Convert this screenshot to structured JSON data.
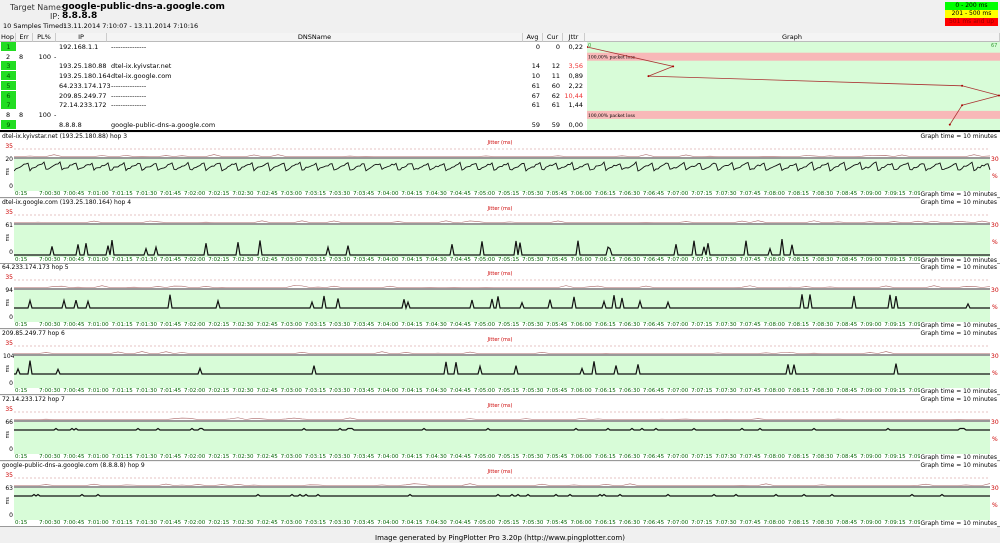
{
  "header": {
    "target_label": "Target Name:",
    "target_value": "google-public-dns-a.google.com",
    "ip_label": "IP:",
    "ip_value": "8.8.8.8",
    "samples_label": "10 Samples Timed:",
    "samples_value": "13.11.2014 7:10:07 - 13.11.2014 7:10:16"
  },
  "legend": [
    {
      "label": "0 - 200 ms",
      "color": "#00ff00"
    },
    {
      "label": "201 - 500 ms",
      "color": "#ffff00"
    },
    {
      "label": "501 ms and up",
      "color": "#ff0000"
    }
  ],
  "table": {
    "columns": [
      "Hop",
      "Err",
      "PL%",
      "IP",
      "DNSName",
      "Avg",
      "Cur",
      "Jttr",
      "Graph"
    ],
    "rows": [
      {
        "hop": "1",
        "err": "",
        "pl": "",
        "ip": "192.168.1.1",
        "dns": "---------------",
        "avg": "0",
        "cur": "0",
        "jttr": "0,22",
        "ok": true,
        "jttr_red": false
      },
      {
        "hop": "2",
        "err": "8",
        "pl": "100",
        "ip": "-",
        "dns": "",
        "avg": "",
        "cur": "",
        "jttr": "",
        "ok": false,
        "jttr_red": false
      },
      {
        "hop": "3",
        "err": "",
        "pl": "",
        "ip": "193.25.180.88",
        "dns": "dtel-ix.kyivstar.net",
        "avg": "14",
        "cur": "12",
        "jttr": "3,56",
        "ok": true,
        "jttr_red": true
      },
      {
        "hop": "4",
        "err": "",
        "pl": "",
        "ip": "193.25.180.164",
        "dns": "dtel-ix.google.com",
        "avg": "10",
        "cur": "11",
        "jttr": "0,89",
        "ok": true,
        "jttr_red": false
      },
      {
        "hop": "5",
        "err": "",
        "pl": "",
        "ip": "64.233.174.173",
        "dns": "---------------",
        "avg": "61",
        "cur": "60",
        "jttr": "2,22",
        "ok": true,
        "jttr_red": false
      },
      {
        "hop": "6",
        "err": "",
        "pl": "",
        "ip": "209.85.249.77",
        "dns": "---------------",
        "avg": "67",
        "cur": "62",
        "jttr": "10,44",
        "ok": true,
        "jttr_red": true
      },
      {
        "hop": "7",
        "err": "",
        "pl": "",
        "ip": "72.14.233.172",
        "dns": "---------------",
        "avg": "61",
        "cur": "61",
        "jttr": "1,44",
        "ok": true,
        "jttr_red": false
      },
      {
        "hop": "8",
        "err": "8",
        "pl": "100",
        "ip": "-",
        "dns": "",
        "avg": "",
        "cur": "",
        "jttr": "",
        "ok": false,
        "jttr_red": false
      },
      {
        "hop": "9",
        "err": "",
        "pl": "",
        "ip": "8.8.8.8",
        "dns": "google-public-dns-a.google.com",
        "avg": "59",
        "cur": "59",
        "jttr": "0,00",
        "ok": true,
        "jttr_red": false
      }
    ],
    "graph_min": "0",
    "graph_max": "67",
    "loss_text": "100,00% packet loss"
  },
  "panels": [
    {
      "title": "dtel-ix.kyivstar.net (193.25.180.88) hop 3",
      "scale": "20",
      "style": "saw"
    },
    {
      "title": "dtel-ix.google.com (193.25.180.164) hop 4",
      "scale": "61",
      "style": "spikes-low"
    },
    {
      "title": "64.233.174.173 hop 5",
      "scale": "94",
      "style": "spikes-mid"
    },
    {
      "title": "209.85.249.77 hop 6",
      "scale": "104",
      "style": "spikes-mid"
    },
    {
      "title": "72.14.233.172 hop 7",
      "scale": "66",
      "style": "flat-high"
    },
    {
      "title": "google-public-dns-a.google.com (8.8.8.8) hop 9",
      "scale": "63",
      "style": "flat-high"
    }
  ],
  "panel_common": {
    "jitter_label": "Jitter (ms)",
    "jitter_max": "35",
    "zero": "0",
    "unit": "ms",
    "loss_max": "30",
    "loss_unit": "%",
    "graph_time": "Graph time = 10 minutes"
  },
  "time_labels": [
    "0:15",
    "7:00:30",
    "7:00:45",
    "7:01:00",
    "7:01:15",
    "7:01:30",
    "7:01:45",
    "7:02:00",
    "7:02:15",
    "7:02:30",
    "7:02:45",
    "7:03:00",
    "7:03:15",
    "7:03:30",
    "7:03:45",
    "7:04:00",
    "7:04:15",
    "7:04:30",
    "7:04:45",
    "7:05:00",
    "7:05:15",
    "7:05:30",
    "7:05:45",
    "7:06:00",
    "7:06:15",
    "7:06:30",
    "7:06:45",
    "7:07:00",
    "7:07:15",
    "7:07:30",
    "7:07:45",
    "7:08:00",
    "7:08:15",
    "7:08:30",
    "7:08:45",
    "7:09:00",
    "7:09:15",
    "7:09:30",
    "7:09:45",
    "7:10:00",
    "7:1"
  ],
  "footer": "Image generated by PingPlotter Pro 3.20p (http://www.pingplotter.com)"
}
